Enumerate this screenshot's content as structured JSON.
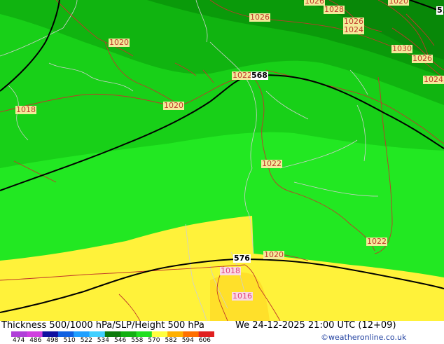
{
  "colors": {
    "green_dark": "#0a9a0a",
    "green_mid": "#10b410",
    "green_light": "#18d018",
    "green_bright": "#22e822",
    "yellow": "#fff23a",
    "yellow_deep": "#ffe02a",
    "thickness_line": "#000000",
    "slp_line": "#c0392b",
    "border_line": "#c8c8c8"
  },
  "map": {
    "slp_labels": [
      "1026",
      "1028",
      "1020",
      "1026",
      "1026",
      "1024",
      "1030",
      "1026",
      "1024",
      "1020",
      "1022",
      "1018",
      "1020",
      "1022",
      "1022",
      "1020",
      "1016"
    ],
    "slp_low_labels": [
      "1018",
      "1016"
    ],
    "height_labels": [
      "568",
      "576"
    ],
    "edge_label": "5"
  },
  "footer": {
    "title": "Thickness 500/1000 hPa/SLP/Height 500 hPa",
    "datetime": "We 24-12-2025 21:00 UTC (12+09)",
    "copyright": "©weatheronline.co.uk"
  },
  "legend": {
    "ticks": [
      "474",
      "486",
      "498",
      "510",
      "522",
      "534",
      "546",
      "558",
      "570",
      "582",
      "594",
      "606"
    ],
    "colors": [
      "#b040d8",
      "#d040e0",
      "#1010a0",
      "#1060e0",
      "#20a0ff",
      "#40d0ff",
      "#0a7a0a",
      "#10b010",
      "#20e020",
      "#ffff40",
      "#ffb000",
      "#ff7000",
      "#e02020"
    ]
  }
}
